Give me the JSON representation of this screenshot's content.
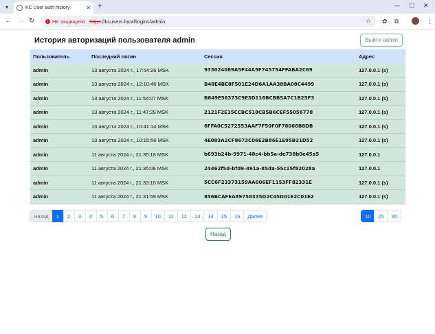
{
  "browser": {
    "tab_title": "KC User auth history",
    "not_secure_label": "Не защищено",
    "url_scheme": "https",
    "url_rest": "://kcusers.local/logins/admin"
  },
  "page": {
    "title": "История авторизаций пользователя admin",
    "logout_label": "Выйти admin",
    "back_label": "Назад"
  },
  "table": {
    "headers": [
      "Пользователь",
      "Последний логин",
      "Сессия",
      "Адрес"
    ],
    "rows": [
      {
        "user": "admin",
        "login": "13 августа 2024 г., 17:54:26 MSK",
        "session": "933024069A5F44A5F745754FFABA2C69",
        "address": "127.0.0.1 (s)",
        "highlight": true
      },
      {
        "user": "admin",
        "login": "13 августа 2024 г., 12:10:46 MSK",
        "session": "B48E4BE8F501E24D6A1AA38BA08C4499",
        "address": "127.0.0.1 (s)",
        "highlight": true
      },
      {
        "user": "admin",
        "login": "13 августа 2024 г., 11:54:07 MSK",
        "session": "B849E56373C9E3D116BCBB5A7C1B25F3",
        "address": "127.0.0.1 (s)",
        "highlight": true
      },
      {
        "user": "admin",
        "login": "13 августа 2024 г., 11:47:29 MSK",
        "session": "2121F2E15CCBC518CB5B6CEF55056778",
        "address": "127.0.0.1 (s)",
        "highlight": true
      },
      {
        "user": "admin",
        "login": "13 августа 2024 г., 10:41:14 MSK",
        "session": "6FFA0C5272553AAF7F50F0F78066B8DB",
        "address": "127.0.0.1 (s)",
        "highlight": true
      },
      {
        "user": "admin",
        "login": "13 августа 2024 г., 10:15:56 MSK",
        "session": "4E083A2CF8673C06E2B86E1E95B21D52",
        "address": "127.0.0.1 (s)",
        "highlight": true
      },
      {
        "user": "admin",
        "login": "11 августа 2024 г., 21:35:18 MSK",
        "session": "b693b24b-9971-48c4-bb5a-de738b0e45a5",
        "address": "127.0.0.1",
        "highlight": true
      },
      {
        "user": "admin",
        "login": "11 августа 2024 г., 21:35:08 MSK",
        "session": "24462f5d-bfd9-491a-85da-55c15f82028a",
        "address": "127.0.0.1",
        "highlight": true
      },
      {
        "user": "admin",
        "login": "11 августа 2024 г., 21:33:10 MSK",
        "session": "5CC6F23373159AA006EF1153FF82331E",
        "address": "127.0.0.1 (s)",
        "highlight": true
      },
      {
        "user": "admin",
        "login": "11 августа 2024 г., 21:31:59 MSK",
        "session": "856BCAFEA89758335D2C45D01E2C01E2",
        "address": "127.0.0.1 (s)",
        "highlight": true
      }
    ]
  },
  "pagination": {
    "prev_label": "Назад",
    "pages": [
      "1",
      "2",
      "3",
      "4",
      "5",
      "6",
      "7",
      "8",
      "9",
      "10",
      "11",
      "12",
      "13",
      "14",
      "15",
      "16"
    ],
    "active_page": "1",
    "next_label": "Далее",
    "page_sizes": [
      "10",
      "20",
      "30"
    ],
    "active_size": "10"
  },
  "colors": {
    "row_highlight": "#d1e7dd",
    "header_bg": "#cfe2ff",
    "accent": "#0d6efd"
  }
}
